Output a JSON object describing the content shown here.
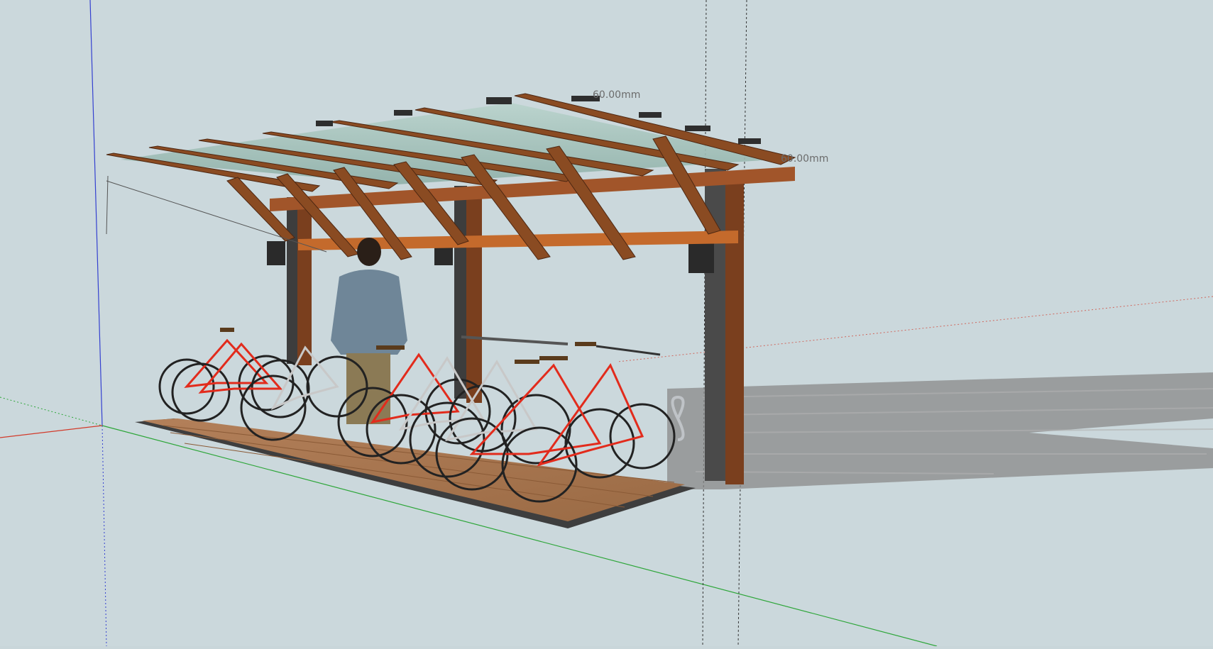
{
  "viewport": {
    "background": "#cbd8dc",
    "axis_colors": {
      "red": "#d23a2a",
      "green": "#2ea63a",
      "blue": "#3440d0"
    }
  },
  "dimensions": {
    "top_beam_label": "60.00mm",
    "side_label": "60.00mm"
  },
  "model": {
    "bike_colors": [
      "#e22b1c",
      "#c8c8c8",
      "#e22b1c",
      "#c8c8c8",
      "#e22b1c",
      "#c8c8c8",
      "#e22b1c",
      "#c8c8c8"
    ],
    "wood_color": "#8a4b22",
    "post_color": "#4a4a4a",
    "deck_color": "#a9774b",
    "glass_color": "#a9c7bf"
  }
}
